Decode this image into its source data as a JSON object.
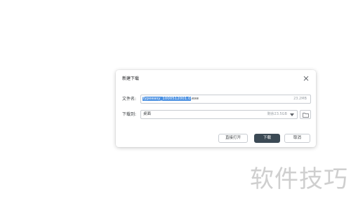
{
  "dialog": {
    "title": "新建下载",
    "close_icon": "close-icon",
    "filename": {
      "label": "文件名:",
      "selected_text": "Typeeasy_1000512001.0",
      "extension": ".exe",
      "size": "23.2MB"
    },
    "destination": {
      "label": "下载到:",
      "value": "桌面",
      "free_space": "剩余23.5GB",
      "folder_icon": "folder-icon"
    },
    "buttons": {
      "open": "直接打开",
      "download": "下载",
      "cancel": "取消"
    },
    "colors": {
      "selection": "#4a90e2",
      "primary_button": "#3c4a55"
    }
  },
  "watermark": "软件技巧"
}
